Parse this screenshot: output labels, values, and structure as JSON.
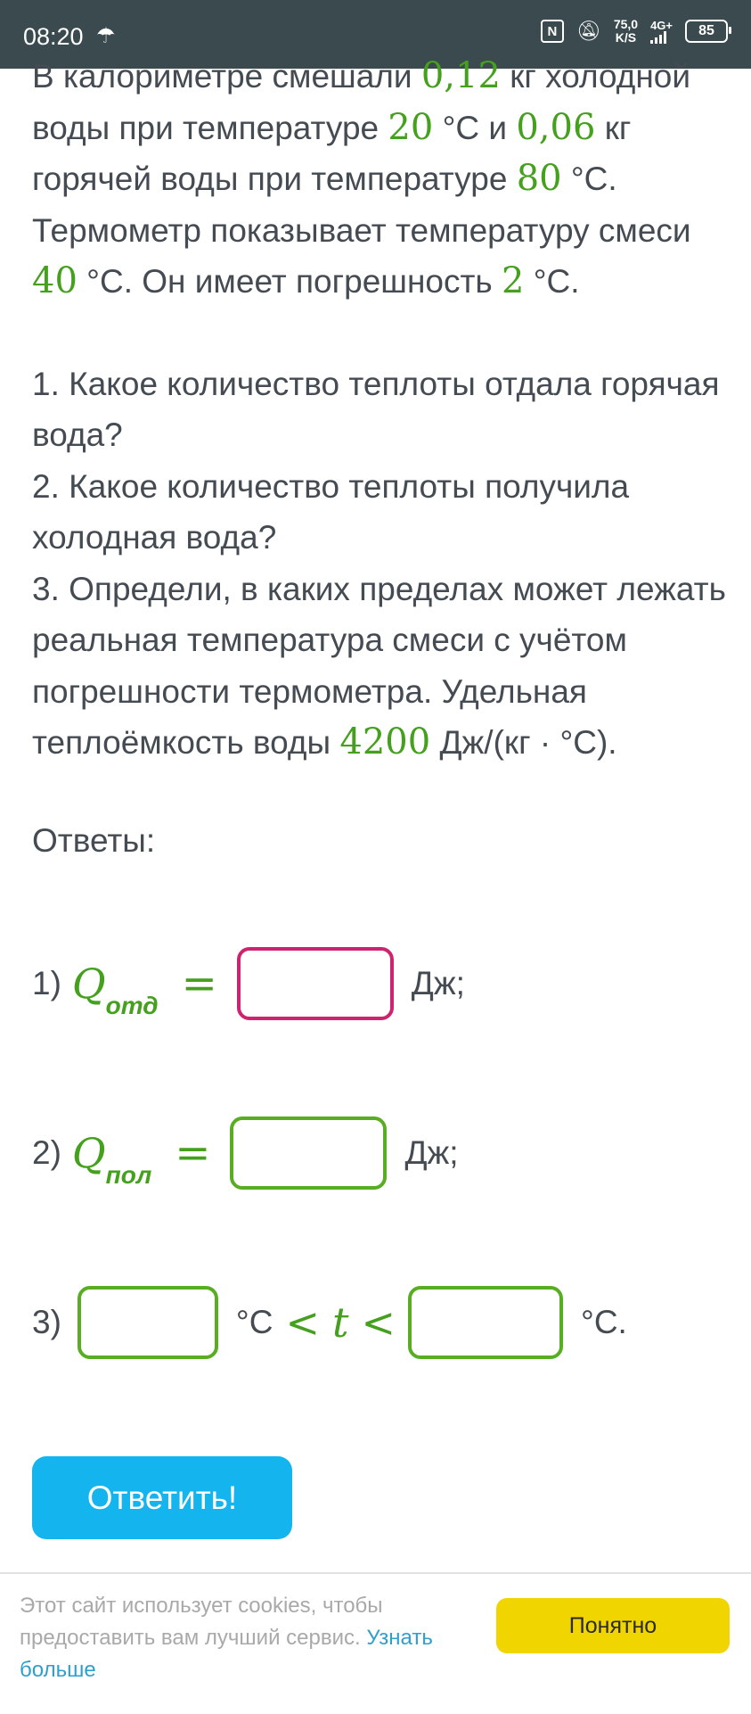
{
  "status_bar": {
    "time": "08:20",
    "speed_value": "75,0",
    "speed_unit": "K/S",
    "network": "4G+",
    "battery": "85"
  },
  "problem": {
    "p1": [
      "В калориметре смешали ",
      "0,12",
      " кг холодной воды при температуре ",
      "20",
      " °C и ",
      "0,06",
      " кг горячей воды при температуре ",
      "80",
      " °C. Термометр показывает температуру смеси ",
      "40",
      " °C. Он имеет погрешность ",
      "2",
      " °C."
    ],
    "q1_num": "1.",
    "q1_text": " Какое количество теплоты отдала горячая вода?",
    "q2_num": "2.",
    "q2_text": " Какое количество теплоты получила холодная вода?",
    "q3_num": "3.",
    "q3_text": " Определи, в каких пределах может лежать реальная температура смеси с учётом погрешности термометра. Удельная теплоёмкость воды ",
    "q3_value": "4200",
    "q3_unit": " Дж/(кг · °C)."
  },
  "answers": {
    "title": "Ответы:",
    "a1": {
      "label": "1)",
      "symbol": "Q",
      "subscript": "отд",
      "eq": "=",
      "unit": "Дж;"
    },
    "a2": {
      "label": "2)",
      "symbol": "Q",
      "subscript": "пол",
      "eq": "=",
      "unit": "Дж;"
    },
    "a3": {
      "label": "3)",
      "unit1": "°C",
      "lt": "<",
      "var": "t",
      "unit2": "°C."
    }
  },
  "submit_label": "Ответить!",
  "cookie": {
    "text": "Этот сайт использует cookies, чтобы предоставить вам лучший сервис. ",
    "link": "Узнать больше",
    "button": "Понятно"
  }
}
